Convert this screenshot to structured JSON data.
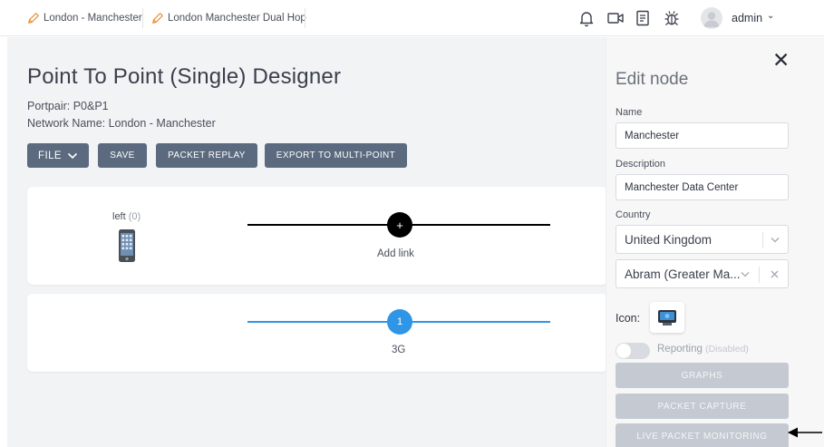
{
  "topbar": {
    "tabs": [
      {
        "label": "London - Manchester",
        "icon": "pencil-icon"
      },
      {
        "label": "London Manchester Dual Hop",
        "icon": "pencil-icon"
      }
    ],
    "icons": [
      "bell-icon",
      "video-icon",
      "document-icon",
      "bug-icon"
    ],
    "user": "admin",
    "user_chevron": "⌄"
  },
  "page": {
    "title": "Point To Point (Single) Designer",
    "portpair": "Portpair: P0&P1",
    "network_name": "Network Name: London - Manchester",
    "buttons": {
      "file": "FILE",
      "save": "SAVE",
      "packet_replay": "PACKET REPLAY",
      "export": "EXPORT TO MULTI-POINT"
    }
  },
  "canvas": {
    "left_node": {
      "label": "left",
      "count": "(0)",
      "icon": "mobile-phone-icon"
    },
    "add_link": {
      "symbol": "+",
      "label": "Add link",
      "color": "#000000"
    },
    "link": {
      "number": "1",
      "label": "3G",
      "color": "#2f95e6"
    }
  },
  "edit_panel": {
    "close": "✕",
    "title": "Edit node",
    "name_label": "Name",
    "name_value": "Manchester",
    "description_label": "Description",
    "description_value": "Manchester Data Center",
    "country_label": "Country",
    "country_value": "United Kingdom",
    "city_value": "Abram (Greater Ma...",
    "icon_label": "Icon:",
    "reporting_label": "Reporting",
    "reporting_status": "(Disabled)",
    "buttons": {
      "graphs": "GRAPHS",
      "packet_capture": "PACKET CAPTURE",
      "live_monitoring": "LIVE PACKET MONITORING"
    }
  },
  "colors": {
    "primary_button": "#5b6a7f",
    "disabled_button": "#c5cad2",
    "link_blue": "#2f95e6",
    "pencil_orange": "#e8892c"
  }
}
